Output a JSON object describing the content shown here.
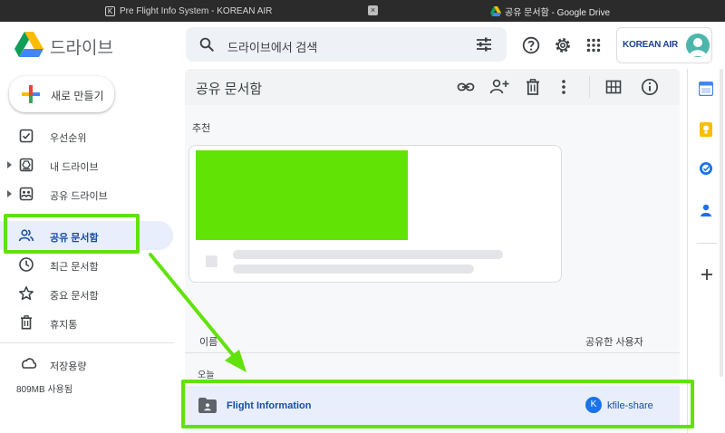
{
  "browser": {
    "tabs": [
      {
        "title": "Pre Flight Info System - KOREAN AIR",
        "favicon": "K"
      },
      {
        "title": "공유 문서함 - Google Drive"
      }
    ],
    "tab_close_glyph": "×"
  },
  "header": {
    "app_name": "드라이브",
    "search_placeholder": "드라이브에서 검색",
    "org_logo": "KOREAN AIR"
  },
  "sidebar": {
    "new_button": "새로 만들기",
    "items": [
      {
        "label": "우선순위",
        "icon": "priority-icon"
      },
      {
        "label": "내 드라이브",
        "icon": "my-drive-icon",
        "expandable": true
      },
      {
        "label": "공유 드라이브",
        "icon": "shared-drive-icon",
        "expandable": true
      },
      {
        "label": "공유 문서함",
        "icon": "people-icon",
        "selected": true
      },
      {
        "label": "최근 문서함",
        "icon": "clock-icon"
      },
      {
        "label": "중요 문서함",
        "icon": "star-icon"
      },
      {
        "label": "휴지통",
        "icon": "trash-icon"
      }
    ],
    "storage_label": "저장용량",
    "storage_used": "809MB 사용됨"
  },
  "main": {
    "title": "공유 문서함",
    "suggested_label": "추천",
    "columns": {
      "name": "이름",
      "shared_by": "공유한 사용자"
    },
    "group_label": "오늘",
    "files": [
      {
        "name": "Flight Information",
        "sharer": "kfile-share",
        "sharer_initial": "K"
      }
    ]
  },
  "colors": {
    "annotation_green": "#61e20a",
    "selected_bg": "#e8eefb",
    "selected_text": "#174ea6",
    "accent_blue": "#1a73e8"
  }
}
